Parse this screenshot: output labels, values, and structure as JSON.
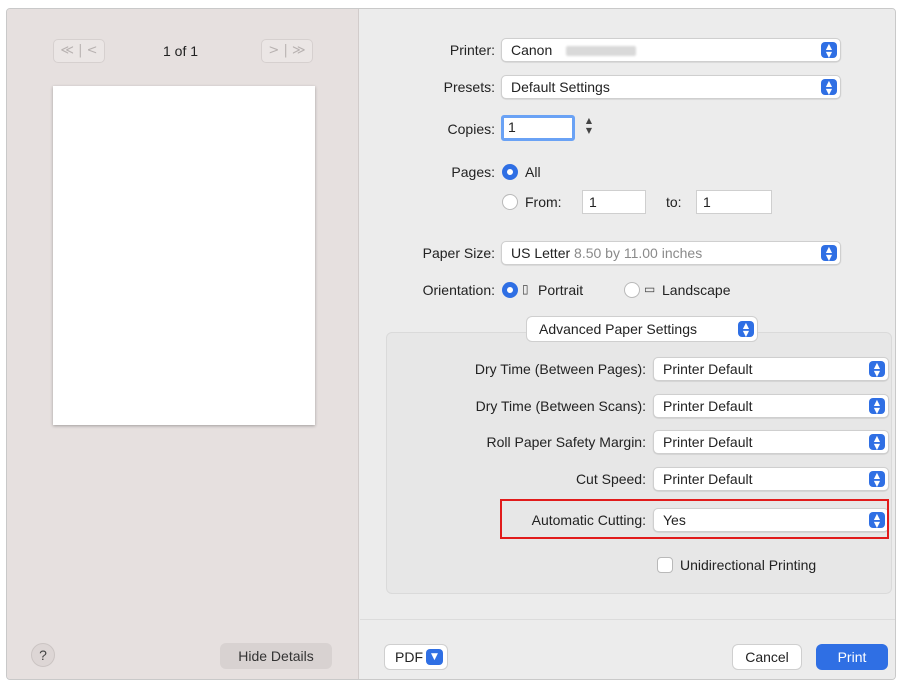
{
  "preview": {
    "first_prev_symbol": "≪ | <",
    "next_last_symbol": "> | ≫",
    "page_counter": "1 of 1",
    "help_label": "?",
    "hide_details_label": "Hide Details"
  },
  "printer": {
    "label": "Printer:",
    "value": "Canon"
  },
  "presets": {
    "label": "Presets:",
    "value": "Default Settings"
  },
  "copies": {
    "label": "Copies:",
    "value": "1"
  },
  "pages": {
    "label": "Pages:",
    "all_label": "All",
    "from_label": "From:",
    "from_value": "1",
    "to_label": "to:",
    "to_value": "1",
    "selected": "All"
  },
  "paper_size": {
    "label": "Paper Size:",
    "value": "US Letter",
    "detail": "8.50 by 11.00 inches"
  },
  "orientation": {
    "label": "Orientation:",
    "portrait_label": "Portrait",
    "landscape_label": "Landscape",
    "selected": "Portrait"
  },
  "advanced": {
    "section_label": "Advanced Paper Settings",
    "settings": [
      {
        "label": "Dry Time (Between Pages):",
        "value": "Printer Default"
      },
      {
        "label": "Dry Time (Between Scans):",
        "value": "Printer Default"
      },
      {
        "label": "Roll Paper Safety Margin:",
        "value": "Printer Default"
      },
      {
        "label": "Cut Speed:",
        "value": "Printer Default"
      },
      {
        "label": "Automatic Cutting:",
        "value": "Yes"
      }
    ],
    "unidirectional_label": "Unidirectional Printing",
    "unidirectional_checked": false
  },
  "footer": {
    "pdf_label": "PDF",
    "cancel_label": "Cancel",
    "print_label": "Print"
  },
  "colors": {
    "accent": "#2f6fe4",
    "highlight": "#e11b1b"
  }
}
